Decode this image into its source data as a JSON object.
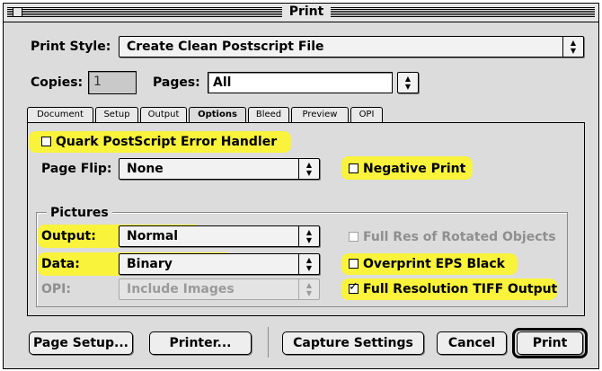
{
  "window": {
    "title": "Print"
  },
  "top": {
    "print_style_label": "Print Style:",
    "print_style_value": "Create Clean Postscript File",
    "copies_label": "Copies:",
    "copies_value": "1",
    "pages_label": "Pages:",
    "pages_value": "All"
  },
  "tabs": [
    {
      "label": "Document"
    },
    {
      "label": "Setup"
    },
    {
      "label": "Output"
    },
    {
      "label": "Options"
    },
    {
      "label": "Bleed"
    },
    {
      "label": "Preview"
    },
    {
      "label": "OPI"
    }
  ],
  "active_tab": "Options",
  "options": {
    "quark_handler": {
      "label": "Quark PostScript Error Handler",
      "checked": false
    },
    "page_flip_label": "Page Flip:",
    "page_flip_value": "None",
    "negative_print": {
      "label": "Negative Print",
      "checked": false
    }
  },
  "pictures": {
    "group_label": "Pictures",
    "output_label": "Output:",
    "output_value": "Normal",
    "data_label": "Data:",
    "data_value": "Binary",
    "opi_label": "OPI:",
    "opi_value": "Include Images",
    "full_res_rotated": {
      "label": "Full Res of Rotated Objects",
      "checked": false,
      "enabled": false
    },
    "overprint_eps": {
      "label": "Overprint EPS Black",
      "checked": false
    },
    "full_res_tiff": {
      "label": "Full Resolution TIFF Output",
      "checked": true
    }
  },
  "buttons": {
    "page_setup": "Page Setup...",
    "printer": "Printer...",
    "capture": "Capture Settings",
    "cancel": "Cancel",
    "print": "Print"
  },
  "icons": {
    "popup_arrows": "up-down-arrows-icon",
    "checkmark": "checkmark-icon"
  },
  "colors": {
    "highlight": "#f9f33b",
    "window_bg": "#dcdcdc"
  }
}
